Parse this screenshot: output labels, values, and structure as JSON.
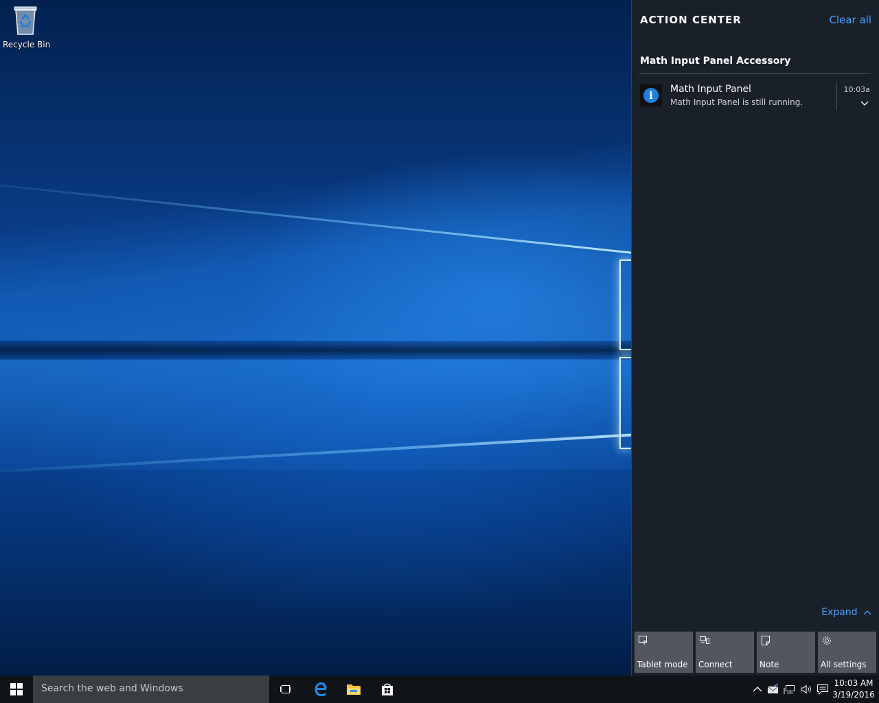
{
  "desktop": {
    "icons": [
      {
        "label": "Recycle Bin",
        "icon": "recycle-bin-icon"
      }
    ]
  },
  "action_center": {
    "title": "ACTION CENTER",
    "clear_all": "Clear all",
    "group_title": "Math Input Panel Accessory",
    "notification": {
      "app": "Math Input Panel",
      "message": "Math Input Panel is still running.",
      "time": "10:03a",
      "icon": "info-icon"
    },
    "expand_label": "Expand",
    "quick_actions": [
      {
        "label": "Tablet mode",
        "icon": "tablet-mode-icon"
      },
      {
        "label": "Connect",
        "icon": "connect-icon"
      },
      {
        "label": "Note",
        "icon": "note-icon"
      },
      {
        "label": "All settings",
        "icon": "gear-icon"
      }
    ]
  },
  "taskbar": {
    "search_placeholder": "Search the web and Windows",
    "pinned": [
      "task-view-icon",
      "edge-icon",
      "file-explorer-icon",
      "store-icon"
    ],
    "tray_icons": [
      "chevron-up-icon",
      "mail-icon",
      "network-icon",
      "volume-icon",
      "action-center-icon"
    ],
    "clock": {
      "time": "10:03 AM",
      "date": "3/19/2016"
    }
  },
  "colors": {
    "accent": "#4aa3ff",
    "info_blue": "#1e7fe0",
    "taskbar": "#101418",
    "tile": "#52575f"
  }
}
